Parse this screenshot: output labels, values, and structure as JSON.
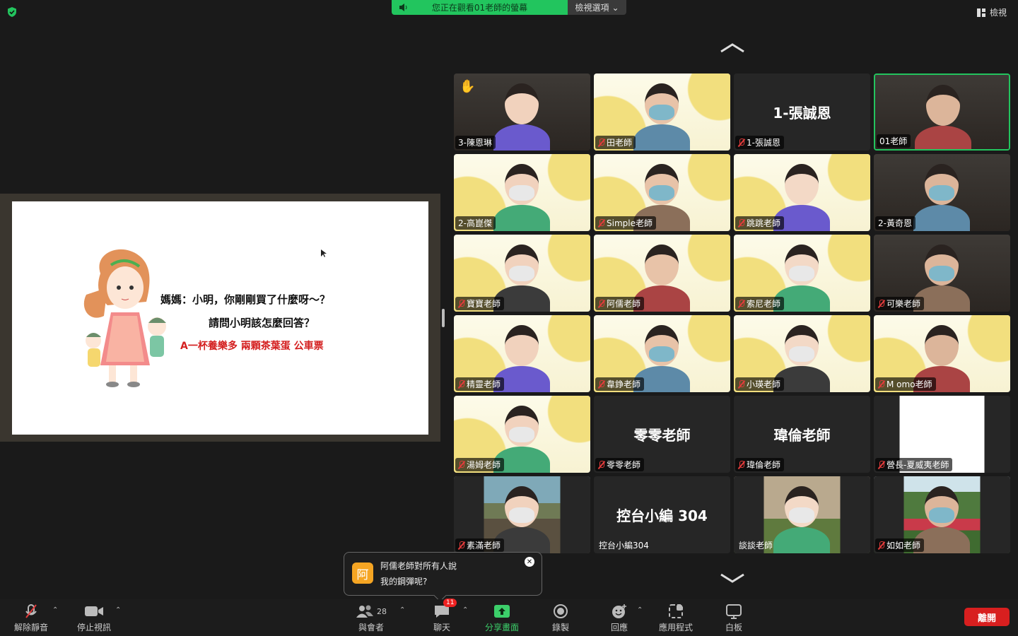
{
  "banner": {
    "text": "您正在觀看01老師的螢幕",
    "options_label": "檢視選項"
  },
  "view_button": "檢視",
  "slide": {
    "line1": "媽媽：小明，你剛剛買了什麼呀～？",
    "line2": "請問小明該怎麼回答？",
    "line3": "A一杯養樂多 兩顆茶葉蛋 公車票"
  },
  "tiles": [
    {
      "label": "3-陳恩琳",
      "muted": false,
      "kind": "video",
      "hand": true
    },
    {
      "label": "田老師",
      "muted": true,
      "kind": "yellow"
    },
    {
      "label": "1-張誠恩",
      "muted": true,
      "kind": "name",
      "big": "1-張誠恩"
    },
    {
      "label": "01老師",
      "muted": false,
      "kind": "video",
      "active": true
    },
    {
      "label": "2-高崑傑",
      "muted": false,
      "kind": "yellow"
    },
    {
      "label": "Simple老師",
      "muted": true,
      "kind": "yellow"
    },
    {
      "label": "跳跳老師",
      "muted": true,
      "kind": "yellow"
    },
    {
      "label": "2-黃奇恩",
      "muted": false,
      "kind": "video"
    },
    {
      "label": "寶寶老師",
      "muted": true,
      "kind": "yellow"
    },
    {
      "label": "阿儒老師",
      "muted": true,
      "kind": "yellow"
    },
    {
      "label": "索尼老師",
      "muted": true,
      "kind": "yellow"
    },
    {
      "label": "可樂老師",
      "muted": true,
      "kind": "video"
    },
    {
      "label": "精靈老師",
      "muted": true,
      "kind": "yellow"
    },
    {
      "label": "韋錚老師",
      "muted": true,
      "kind": "yellow"
    },
    {
      "label": "小瑛老師",
      "muted": true,
      "kind": "yellow"
    },
    {
      "label": "M omo老師",
      "muted": true,
      "kind": "yellow"
    },
    {
      "label": "湯姆老師",
      "muted": true,
      "kind": "yellow"
    },
    {
      "label": "零零老師",
      "muted": true,
      "kind": "name",
      "big": "零零老師"
    },
    {
      "label": "瑋倫老師",
      "muted": true,
      "kind": "name",
      "big": "瑋倫老師"
    },
    {
      "label": "營長-夏威夷老師",
      "muted": true,
      "kind": "white"
    },
    {
      "label": "素滿老師",
      "muted": true,
      "kind": "photo"
    },
    {
      "label": "控台小編304",
      "muted": false,
      "kind": "name",
      "big": "控台小編 304",
      "plain": true
    },
    {
      "label": "談談老師",
      "muted": false,
      "kind": "photo2",
      "plain": true
    },
    {
      "label": "如如老師",
      "muted": true,
      "kind": "photo3"
    }
  ],
  "toast": {
    "avatar": "阿",
    "line1": "阿儒老師對所有人說",
    "line2": "我的鋼彈呢?",
    "close": "✕"
  },
  "toolbar": {
    "unmute": "解除靜音",
    "stop_video": "停止視訊",
    "participants": "與會者",
    "participant_count": "28",
    "chat": "聊天",
    "chat_badge": "11",
    "share": "分享畫面",
    "record": "錄製",
    "reactions": "回應",
    "apps": "應用程式",
    "whiteboard": "白板",
    "leave": "離開"
  },
  "colors": {
    "active_border": "#23c45e",
    "banner": "#22c55e",
    "leave": "#d81f1f",
    "muted_mic": "#e23b3b"
  }
}
